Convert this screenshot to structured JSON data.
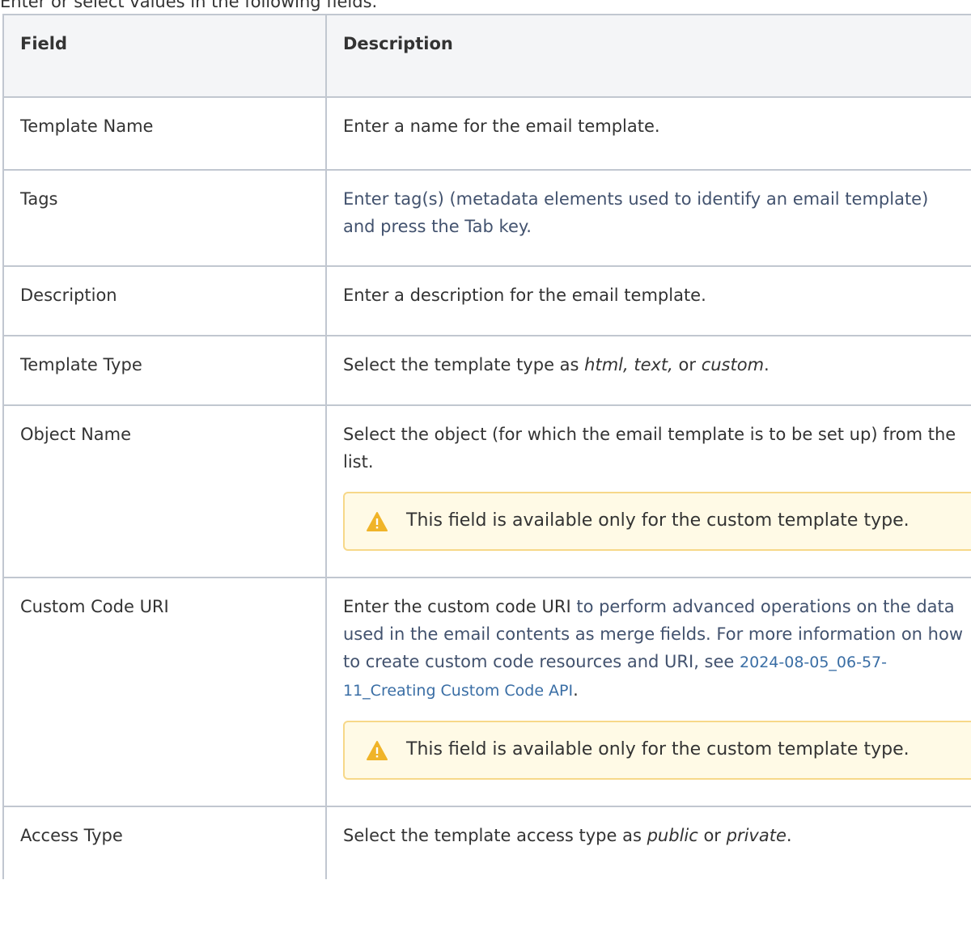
{
  "intro": "Enter or select values in the following fields.",
  "table": {
    "headers": [
      "Field",
      "Description"
    ],
    "rows": [
      {
        "field": "Template Name",
        "desc": "Enter a name for the email template."
      },
      {
        "field": "Tags",
        "desc": "Enter tag(s) (metadata elements used to identify an email template) and press the Tab key."
      },
      {
        "field": "Description",
        "desc": "Enter a description for the email template."
      },
      {
        "field": "Template Type",
        "desc_pre": "Select the template type as ",
        "desc_em1": "html, text,",
        "desc_mid": " or ",
        "desc_em2": "custom",
        "desc_post": "."
      },
      {
        "field": "Object Name",
        "desc": "Select the object (for which the email template is to be set up) from the list.",
        "note": "This field is available only for the custom template type."
      },
      {
        "field": "Custom Code URI",
        "desc_pre": "Enter the custom code URI",
        "desc_blue": " to perform advanced operations on the data used in the email contents as merge fields. For more information on how to create custom code resources and URI, see ",
        "desc_link": "2024-08-05_06-57-11_Creating Custom Code API",
        "desc_post": ".",
        "note": "This field is available only for the custom template type."
      },
      {
        "field": "Access Type",
        "desc_pre": "Select the template access type as ",
        "desc_em1": "public",
        "desc_mid": " or ",
        "desc_em2": "private",
        "desc_post": "."
      }
    ]
  },
  "colors": {
    "note_bg": "#fffae6",
    "note_border": "#f7d889",
    "warn": "#f0b429",
    "link": "#3a6ea5"
  }
}
